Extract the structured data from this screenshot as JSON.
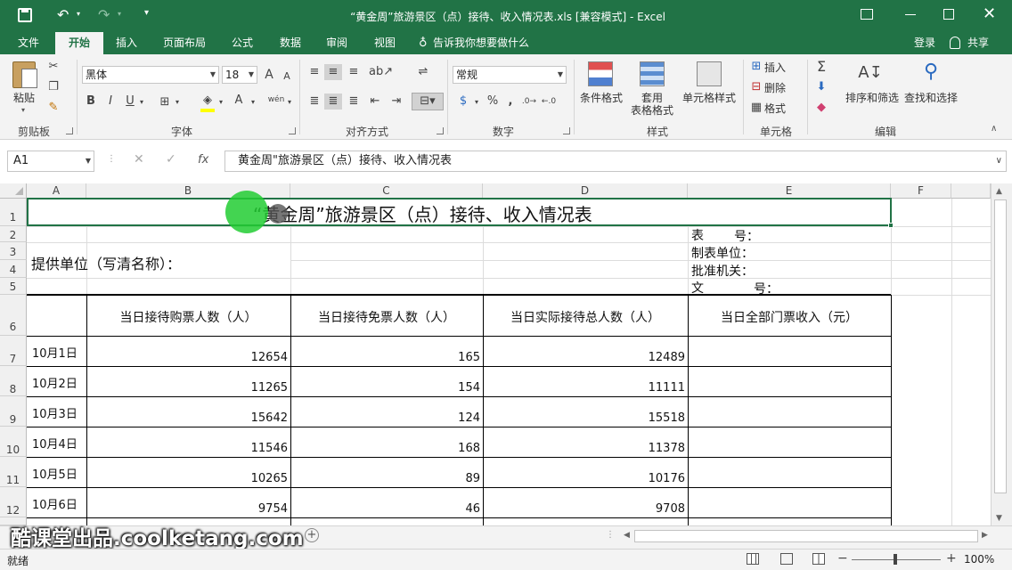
{
  "window": {
    "title": "“黄金周”旅游景区（点）接待、收入情况表.xls  [兼容模式] - Excel",
    "qat": {
      "save": "save-icon",
      "undo": "undo-icon",
      "redo": "redo-icon"
    }
  },
  "tabs": [
    {
      "label": "文件"
    },
    {
      "label": "开始"
    },
    {
      "label": "插入"
    },
    {
      "label": "页面布局"
    },
    {
      "label": "公式"
    },
    {
      "label": "数据"
    },
    {
      "label": "审阅"
    },
    {
      "label": "视图"
    }
  ],
  "tell_me": "告诉我你想要做什么",
  "login": "登录",
  "share": "共享",
  "ribbon": {
    "clipboard": {
      "label": "剪贴板",
      "paste": "粘贴"
    },
    "font": {
      "label": "字体",
      "name": "黑体",
      "size": "18",
      "bold": "B",
      "italic": "I",
      "underline": "U",
      "grow": "A",
      "shrink": "A",
      "wen": "wén",
      "color_a": "A"
    },
    "align": {
      "label": "对齐方式"
    },
    "number": {
      "label": "数字",
      "format": "常规",
      "percent": "%",
      "comma": ","
    },
    "styles": {
      "label": "样式",
      "cond": "条件格式",
      "table": "套用\n表格格式",
      "cell": "单元格样式"
    },
    "cells": {
      "label": "单元格",
      "insert": "插入",
      "delete": "删除",
      "format": "格式"
    },
    "editing": {
      "label": "编辑",
      "sort": "排序和筛选",
      "find": "查找和选择"
    }
  },
  "formula": {
    "namebox": "A1",
    "fx": "fx",
    "content": "黄金周\"旅游景区（点）接待、收入情况表"
  },
  "columns": [
    "A",
    "B",
    "C",
    "D",
    "E",
    "F"
  ],
  "rows": [
    "1",
    "2",
    "3",
    "4",
    "5",
    "6",
    "7",
    "8",
    "9",
    "10",
    "11",
    "12"
  ],
  "sheet": {
    "title": "“黄金周”旅游景区（点）接待、收入情况表",
    "provider": "提供单位（写清名称）：",
    "meta": {
      "biao": "表",
      "hao": "号：",
      "zhibiao": "制表单位：",
      "pizhun": "批准机关：",
      "wen": "文",
      "wenhao": "号："
    },
    "headers": [
      "当日接待购票人数（人）",
      "当日接待免票人数（人）",
      "当日实际接待总人数（人）",
      "当日全部门票收入（元）"
    ],
    "data": [
      {
        "date": "10月1日",
        "b": "12654",
        "c": "165",
        "d": "12489"
      },
      {
        "date": "10月2日",
        "b": "11265",
        "c": "154",
        "d": "11111"
      },
      {
        "date": "10月3日",
        "b": "15642",
        "c": "124",
        "d": "15518"
      },
      {
        "date": "10月4日",
        "b": "11546",
        "c": "168",
        "d": "11378"
      },
      {
        "date": "10月5日",
        "b": "10265",
        "c": "89",
        "d": "10176"
      },
      {
        "date": "10月6日",
        "b": "9754",
        "c": "46",
        "d": "9708"
      }
    ]
  },
  "watermark": "酷课堂出品.coolketang.com",
  "status": {
    "ready": "就绪",
    "zoom": "100%",
    "add_sheet": "+"
  },
  "colors": {
    "accent": "#217346",
    "ribbon_bg": "#f3f3f3",
    "cursor": "#22cc33"
  }
}
